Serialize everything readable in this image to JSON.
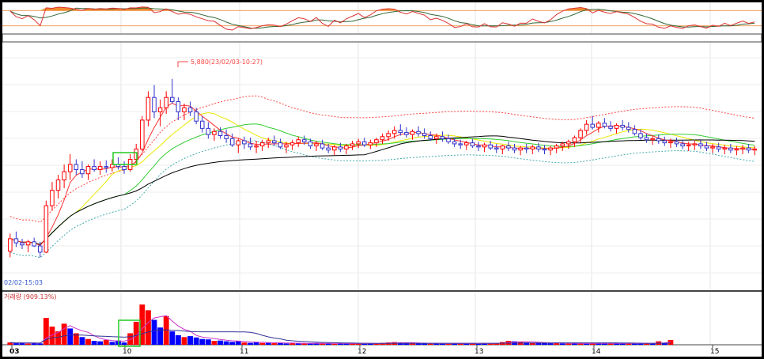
{
  "chart_data": {
    "type": "candlestick",
    "x_ticks": [
      "03",
      "10",
      "11",
      "12",
      "13",
      "14",
      "15"
    ],
    "annotations": {
      "high_label": "5,880(23/02/03-10:27)",
      "low_label": "02/02-15:03",
      "volume_label": "거래량 (909.13%)"
    },
    "panels": {
      "oscillator": {
        "overbought_line": 80,
        "oversold_line": 20,
        "range": [
          0,
          100
        ]
      },
      "price": {
        "ylim": [
          3900,
          6200
        ],
        "indicators": [
          "MA5",
          "MA20",
          "MA60",
          "MA120",
          "Envelope-upper",
          "Envelope-lower"
        ]
      },
      "volume": {
        "ylim": [
          0,
          260
        ],
        "colors": {
          "up": "#ff0000",
          "down": "#0000ff"
        }
      }
    },
    "colors": {
      "up_candle": "#ff0000",
      "down_candle": "#3333cc",
      "ma_short": "#ff3333",
      "ma_mid": "#33cc33",
      "ma_long": "#000000",
      "ma_yellow": "#e8e800",
      "envelope": "#ff4444",
      "envelope_low": "#44aaaa",
      "highlight_box": "#22cc22"
    },
    "candles": [
      [
        4210,
        4380,
        4150,
        4330
      ],
      [
        4330,
        4400,
        4250,
        4290
      ],
      [
        4290,
        4330,
        4230,
        4270
      ],
      [
        4270,
        4320,
        4200,
        4300
      ],
      [
        4300,
        4340,
        4250,
        4260
      ],
      [
        4260,
        4300,
        4150,
        4200
      ],
      [
        4200,
        4700,
        4190,
        4650
      ],
      [
        4650,
        4880,
        4600,
        4800
      ],
      [
        4800,
        4950,
        4720,
        4900
      ],
      [
        4900,
        5050,
        4820,
        4980
      ],
      [
        4980,
        5150,
        4900,
        5050
      ],
      [
        5050,
        5100,
        4950,
        5000
      ],
      [
        5000,
        5080,
        4920,
        4960
      ],
      [
        4960,
        5050,
        4900,
        5030
      ],
      [
        5030,
        5100,
        4980,
        5000
      ],
      [
        5000,
        5080,
        4950,
        5030
      ],
      [
        5030,
        5090,
        4970,
        5020
      ],
      [
        5020,
        5100,
        4980,
        5050
      ],
      [
        5050,
        5120,
        5000,
        5030
      ],
      [
        5030,
        5080,
        4960,
        5000
      ],
      [
        5000,
        5150,
        4980,
        5100
      ],
      [
        5100,
        5250,
        5060,
        5200
      ],
      [
        5200,
        5520,
        5180,
        5480
      ],
      [
        5480,
        5760,
        5420,
        5700
      ],
      [
        5700,
        5820,
        5500,
        5560
      ],
      [
        5560,
        5680,
        5420,
        5600
      ],
      [
        5600,
        5760,
        5540,
        5700
      ],
      [
        5700,
        5880,
        5640,
        5660
      ],
      [
        5660,
        5700,
        5480,
        5560
      ],
      [
        5560,
        5640,
        5480,
        5600
      ],
      [
        5600,
        5660,
        5520,
        5560
      ],
      [
        5560,
        5600,
        5440,
        5470
      ],
      [
        5470,
        5520,
        5360,
        5400
      ],
      [
        5400,
        5460,
        5300,
        5340
      ],
      [
        5340,
        5400,
        5280,
        5370
      ],
      [
        5370,
        5410,
        5300,
        5330
      ],
      [
        5330,
        5390,
        5260,
        5300
      ],
      [
        5300,
        5350,
        5220,
        5240
      ],
      [
        5240,
        5300,
        5160,
        5280
      ],
      [
        5280,
        5320,
        5200,
        5250
      ],
      [
        5250,
        5310,
        5190,
        5220
      ],
      [
        5220,
        5280,
        5160,
        5230
      ],
      [
        5230,
        5290,
        5180,
        5260
      ],
      [
        5260,
        5310,
        5210,
        5280
      ],
      [
        5280,
        5330,
        5230,
        5260
      ],
      [
        5260,
        5300,
        5200,
        5220
      ],
      [
        5220,
        5270,
        5160,
        5240
      ],
      [
        5240,
        5290,
        5190,
        5260
      ],
      [
        5260,
        5320,
        5220,
        5290
      ],
      [
        5290,
        5330,
        5240,
        5270
      ],
      [
        5270,
        5300,
        5200,
        5230
      ],
      [
        5230,
        5280,
        5180,
        5250
      ],
      [
        5250,
        5290,
        5190,
        5210
      ],
      [
        5210,
        5250,
        5160,
        5190
      ],
      [
        5190,
        5240,
        5140,
        5220
      ],
      [
        5220,
        5260,
        5170,
        5200
      ],
      [
        5200,
        5250,
        5150,
        5230
      ],
      [
        5230,
        5280,
        5190,
        5250
      ],
      [
        5250,
        5300,
        5210,
        5270
      ],
      [
        5270,
        5310,
        5220,
        5240
      ],
      [
        5240,
        5290,
        5200,
        5260
      ],
      [
        5260,
        5310,
        5220,
        5290
      ],
      [
        5290,
        5350,
        5250,
        5320
      ],
      [
        5320,
        5380,
        5280,
        5350
      ],
      [
        5350,
        5420,
        5300,
        5380
      ],
      [
        5380,
        5440,
        5330,
        5360
      ],
      [
        5360,
        5410,
        5310,
        5340
      ],
      [
        5340,
        5390,
        5290,
        5370
      ],
      [
        5370,
        5420,
        5320,
        5350
      ],
      [
        5350,
        5400,
        5300,
        5330
      ],
      [
        5330,
        5370,
        5280,
        5300
      ],
      [
        5300,
        5350,
        5250,
        5320
      ],
      [
        5320,
        5370,
        5270,
        5300
      ],
      [
        5300,
        5340,
        5250,
        5270
      ],
      [
        5270,
        5310,
        5220,
        5250
      ],
      [
        5250,
        5290,
        5200,
        5240
      ],
      [
        5240,
        5280,
        5190,
        5260
      ],
      [
        5260,
        5300,
        5210,
        5230
      ],
      [
        5230,
        5270,
        5180,
        5220
      ],
      [
        5220,
        5260,
        5170,
        5240
      ],
      [
        5240,
        5280,
        5190,
        5210
      ],
      [
        5210,
        5250,
        5160,
        5200
      ],
      [
        5200,
        5240,
        5150,
        5230
      ],
      [
        5230,
        5270,
        5180,
        5210
      ],
      [
        5210,
        5250,
        5160,
        5190
      ],
      [
        5190,
        5230,
        5140,
        5210
      ],
      [
        5210,
        5250,
        5160,
        5200
      ],
      [
        5200,
        5240,
        5150,
        5220
      ],
      [
        5220,
        5260,
        5170,
        5200
      ],
      [
        5200,
        5240,
        5150,
        5190
      ],
      [
        5190,
        5230,
        5140,
        5210
      ],
      [
        5210,
        5250,
        5160,
        5230
      ],
      [
        5230,
        5270,
        5180,
        5250
      ],
      [
        5250,
        5290,
        5200,
        5270
      ],
      [
        5270,
        5330,
        5220,
        5310
      ],
      [
        5310,
        5400,
        5260,
        5380
      ],
      [
        5380,
        5480,
        5340,
        5440
      ],
      [
        5440,
        5520,
        5390,
        5410
      ],
      [
        5410,
        5470,
        5360,
        5450
      ],
      [
        5450,
        5500,
        5400,
        5420
      ],
      [
        5420,
        5470,
        5370,
        5400
      ],
      [
        5400,
        5450,
        5350,
        5430
      ],
      [
        5430,
        5480,
        5380,
        5410
      ],
      [
        5410,
        5460,
        5360,
        5390
      ],
      [
        5390,
        5430,
        5330,
        5350
      ],
      [
        5350,
        5390,
        5290,
        5310
      ],
      [
        5310,
        5350,
        5260,
        5290
      ],
      [
        5290,
        5330,
        5240,
        5300
      ],
      [
        5300,
        5340,
        5250,
        5280
      ],
      [
        5280,
        5320,
        5230,
        5260
      ],
      [
        5260,
        5300,
        5210,
        5270
      ],
      [
        5270,
        5310,
        5220,
        5250
      ],
      [
        5250,
        5290,
        5200,
        5230
      ],
      [
        5230,
        5270,
        5180,
        5240
      ],
      [
        5240,
        5280,
        5190,
        5250
      ],
      [
        5250,
        5290,
        5200,
        5230
      ],
      [
        5230,
        5270,
        5180,
        5210
      ],
      [
        5210,
        5250,
        5160,
        5220
      ],
      [
        5220,
        5260,
        5170,
        5200
      ],
      [
        5200,
        5240,
        5150,
        5210
      ],
      [
        5210,
        5250,
        5160,
        5190
      ],
      [
        5190,
        5230,
        5140,
        5200
      ],
      [
        5200,
        5240,
        5150,
        5210
      ],
      [
        5210,
        5250,
        5160,
        5190
      ],
      [
        5190,
        5230,
        5140,
        5200
      ]
    ],
    "volumes": [
      [
        12,
        0
      ],
      [
        8,
        1
      ],
      [
        10,
        1
      ],
      [
        6,
        0
      ],
      [
        9,
        1
      ],
      [
        7,
        1
      ],
      [
        140,
        0
      ],
      [
        95,
        0
      ],
      [
        70,
        0
      ],
      [
        110,
        0
      ],
      [
        85,
        1
      ],
      [
        60,
        0
      ],
      [
        40,
        1
      ],
      [
        30,
        0
      ],
      [
        20,
        1
      ],
      [
        18,
        1
      ],
      [
        25,
        0
      ],
      [
        15,
        1
      ],
      [
        22,
        1
      ],
      [
        12,
        1
      ],
      [
        60,
        0
      ],
      [
        120,
        0
      ],
      [
        210,
        0
      ],
      [
        180,
        0
      ],
      [
        130,
        1
      ],
      [
        90,
        1
      ],
      [
        150,
        0
      ],
      [
        70,
        1
      ],
      [
        50,
        1
      ],
      [
        40,
        0
      ],
      [
        45,
        1
      ],
      [
        38,
        1
      ],
      [
        30,
        1
      ],
      [
        28,
        1
      ],
      [
        20,
        0
      ],
      [
        22,
        1
      ],
      [
        18,
        1
      ],
      [
        15,
        1
      ],
      [
        20,
        1
      ],
      [
        12,
        0
      ],
      [
        10,
        1
      ],
      [
        14,
        1
      ],
      [
        9,
        0
      ],
      [
        11,
        1
      ],
      [
        8,
        0
      ],
      [
        10,
        1
      ],
      [
        7,
        1
      ],
      [
        9,
        0
      ],
      [
        8,
        1
      ],
      [
        6,
        0
      ],
      [
        7,
        1
      ],
      [
        9,
        1
      ],
      [
        6,
        0
      ],
      [
        8,
        1
      ],
      [
        5,
        0
      ],
      [
        7,
        1
      ],
      [
        6,
        1
      ],
      [
        8,
        0
      ],
      [
        7,
        0
      ],
      [
        5,
        1
      ],
      [
        6,
        1
      ],
      [
        8,
        0
      ],
      [
        10,
        0
      ],
      [
        12,
        0
      ],
      [
        14,
        0
      ],
      [
        10,
        1
      ],
      [
        8,
        1
      ],
      [
        9,
        0
      ],
      [
        7,
        1
      ],
      [
        8,
        1
      ],
      [
        6,
        0
      ],
      [
        7,
        1
      ],
      [
        6,
        1
      ],
      [
        5,
        0
      ],
      [
        8,
        1
      ],
      [
        7,
        0
      ],
      [
        6,
        1
      ],
      [
        8,
        0
      ],
      [
        5,
        1
      ],
      [
        7,
        1
      ],
      [
        6,
        0
      ],
      [
        9,
        0
      ],
      [
        14,
        0
      ],
      [
        20,
        0
      ],
      [
        18,
        1
      ],
      [
        16,
        0
      ],
      [
        12,
        1
      ],
      [
        10,
        0
      ],
      [
        11,
        1
      ],
      [
        9,
        1
      ],
      [
        8,
        1
      ],
      [
        10,
        0
      ],
      [
        7,
        1
      ],
      [
        6,
        0
      ],
      [
        8,
        1
      ],
      [
        7,
        0
      ],
      [
        6,
        1
      ],
      [
        9,
        0
      ],
      [
        8,
        1
      ],
      [
        7,
        1
      ],
      [
        6,
        0
      ],
      [
        8,
        1
      ],
      [
        7,
        1
      ],
      [
        9,
        0
      ],
      [
        6,
        1
      ],
      [
        8,
        1
      ],
      [
        7,
        0
      ],
      [
        6,
        1
      ],
      [
        18,
        0
      ],
      [
        10,
        1
      ],
      [
        25,
        0
      ]
    ]
  }
}
